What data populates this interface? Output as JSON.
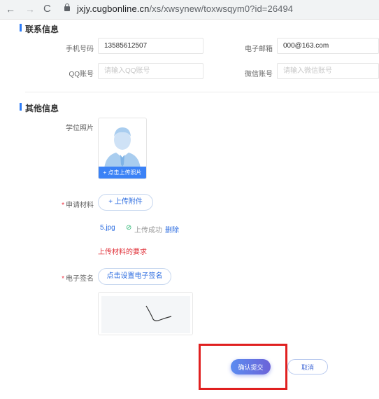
{
  "browser": {
    "back_icon": "←",
    "forward_icon": "→",
    "reload_icon": "C",
    "url_host": "jxjy.cugbonline.cn",
    "url_path": "/xs/xwsynew/toxwsqym0?id=26494"
  },
  "contact": {
    "title": "联系信息",
    "phone_label": "手机号码",
    "phone_value": "13585612507",
    "email_label": "电子邮箱",
    "email_value": "000@163.com",
    "qq_label": "QQ账号",
    "qq_placeholder": "请输入QQ账号",
    "wechat_label": "微信账号",
    "wechat_placeholder": "请输入微信账号"
  },
  "other": {
    "title": "其他信息",
    "photo_label": "学位照片",
    "photo_upload_label": "+ 点击上传照片",
    "material_label": "申请材料",
    "upload_attachment_label": "+ 上传附件",
    "file_name": "5.jpg",
    "file_status": "上传成功",
    "delete_label": "删除",
    "requirement_link": "上传材料的要求",
    "signature_label": "电子签名",
    "signature_button": "点击设置电子签名"
  },
  "actions": {
    "submit_label": "确认提交",
    "cancel_label": "取消"
  },
  "colors": {
    "accent": "#2d7cf6",
    "highlight": "#e02020",
    "warning": "#e0323a"
  }
}
